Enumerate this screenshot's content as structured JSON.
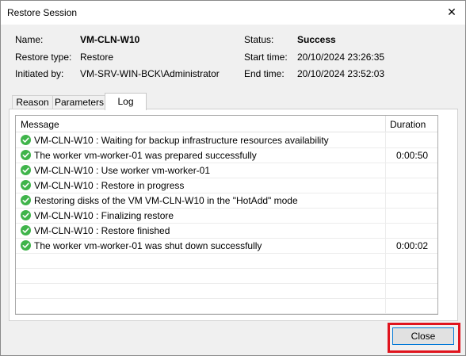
{
  "window": {
    "title": "Restore Session",
    "close_glyph": "✕"
  },
  "info": {
    "name_label": "Name:",
    "name_value": "VM-CLN-W10",
    "restore_type_label": "Restore type:",
    "restore_type_value": "Restore",
    "initiated_by_label": "Initiated by:",
    "initiated_by_value": "VM-SRV-WIN-BCK\\Administrator",
    "status_label": "Status:",
    "status_value": "Success",
    "start_time_label": "Start time:",
    "start_time_value": "20/10/2024 23:26:35",
    "end_time_label": "End time:",
    "end_time_value": "20/10/2024 23:52:03"
  },
  "tabs": [
    {
      "label": "Reason",
      "active": false
    },
    {
      "label": "Parameters",
      "active": false
    },
    {
      "label": "Log",
      "active": true
    }
  ],
  "log": {
    "columns": {
      "message": "Message",
      "duration": "Duration"
    },
    "rows": [
      {
        "status": "success",
        "message": "VM-CLN-W10 : Waiting for backup infrastructure resources availability",
        "duration": ""
      },
      {
        "status": "success",
        "message": "The worker vm-worker-01 was prepared successfully",
        "duration": "0:00:50"
      },
      {
        "status": "success",
        "message": "VM-CLN-W10 : Use worker vm-worker-01",
        "duration": ""
      },
      {
        "status": "success",
        "message": "VM-CLN-W10 : Restore in progress",
        "duration": ""
      },
      {
        "status": "success",
        "message": "Restoring disks of the VM VM-CLN-W10 in the \"HotAdd\" mode",
        "duration": ""
      },
      {
        "status": "success",
        "message": "VM-CLN-W10 : Finalizing restore",
        "duration": ""
      },
      {
        "status": "success",
        "message": "VM-CLN-W10 : Restore finished",
        "duration": ""
      },
      {
        "status": "success",
        "message": "The worker vm-worker-01 was shut down successfully",
        "duration": "0:00:02"
      }
    ]
  },
  "footer": {
    "close_label": "Close"
  },
  "colors": {
    "success_icon": "#3fb44a",
    "highlight": "#e0141e",
    "button_focus": "#0078d7"
  }
}
